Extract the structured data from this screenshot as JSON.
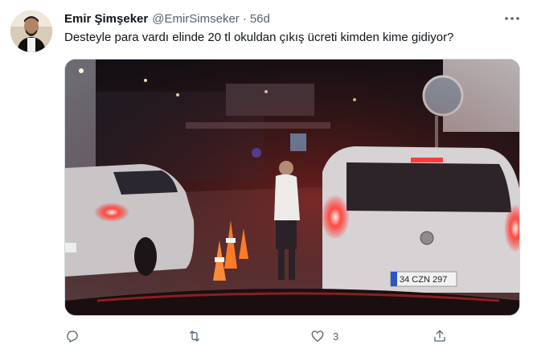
{
  "tweet": {
    "author_name": "Emir Şimşeker",
    "handle": "@EmirSimseker",
    "separator": "·",
    "time": "56d",
    "text": "Desteyle para vardı elinde 20 tl okuldan çıkış ücreti kimden kime gidiyor?",
    "media": {
      "plate_text": "34 CZN 297"
    },
    "actions": {
      "reply": {
        "icon": "reply-icon",
        "count": ""
      },
      "retweet": {
        "icon": "retweet-icon",
        "count": ""
      },
      "like": {
        "icon": "heart-icon",
        "count": "3"
      },
      "share": {
        "icon": "share-icon",
        "count": ""
      }
    }
  },
  "colors": {
    "text_primary": "#0f1419",
    "text_secondary": "#536471",
    "border": "#cfd9de"
  }
}
